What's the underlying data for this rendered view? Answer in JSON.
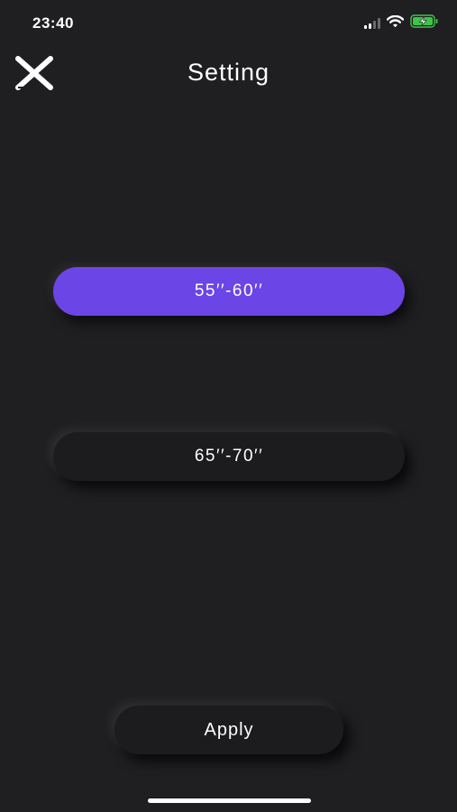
{
  "status_bar": {
    "time": "23:40",
    "icons": [
      "signal-icon",
      "wifi-icon",
      "battery-charging-icon"
    ],
    "battery_color": "#3fc34a"
  },
  "header": {
    "close_icon": "close-icon",
    "title": "Setting"
  },
  "options": [
    {
      "label": "55′′-60′′",
      "selected": true
    },
    {
      "label": "65′′-70′′",
      "selected": false
    }
  ],
  "apply_label": "Apply",
  "colors": {
    "background": "#1f1f22",
    "accent": "#6c45e6",
    "text": "#ffffff"
  }
}
